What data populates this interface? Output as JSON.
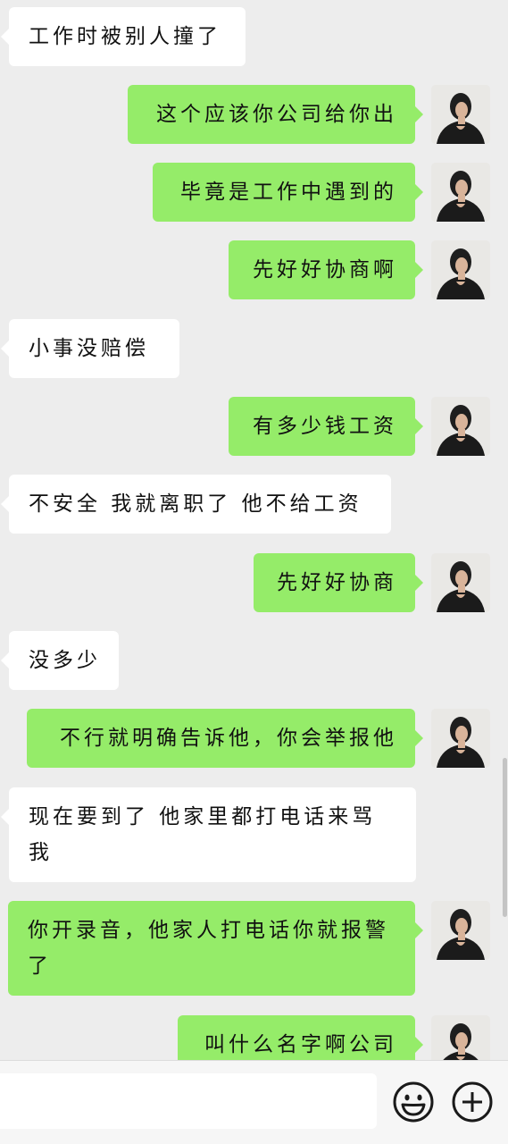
{
  "messages": [
    {
      "side": "in",
      "text": "工作时被别人撞了"
    },
    {
      "side": "out",
      "text": "这个应该你公司给你出"
    },
    {
      "side": "out",
      "text": "毕竟是工作中遇到的"
    },
    {
      "side": "out",
      "text": "先好好协商啊"
    },
    {
      "side": "in",
      "text": "小事没赔偿"
    },
    {
      "side": "out",
      "text": "有多少钱工资"
    },
    {
      "side": "in",
      "text": "不安全 我就离职了 他不给工资"
    },
    {
      "side": "out",
      "text": "先好好协商"
    },
    {
      "side": "in",
      "text": "没多少"
    },
    {
      "side": "out",
      "text": "不行就明确告诉他，你会举报他"
    },
    {
      "side": "in",
      "text": "现在要到了 他家里都打电话来骂我"
    },
    {
      "side": "out",
      "text": "你开录音，他家人打电话你就报警了"
    },
    {
      "side": "out",
      "text": "叫什么名字啊公司"
    }
  ],
  "input": {
    "value": "",
    "placeholder": ""
  },
  "icons": {
    "emoji": "emoji-icon",
    "plus": "plus-circle-icon"
  },
  "colors": {
    "background": "#ededed",
    "outgoing_bubble": "#95ec69",
    "incoming_bubble": "#ffffff"
  }
}
